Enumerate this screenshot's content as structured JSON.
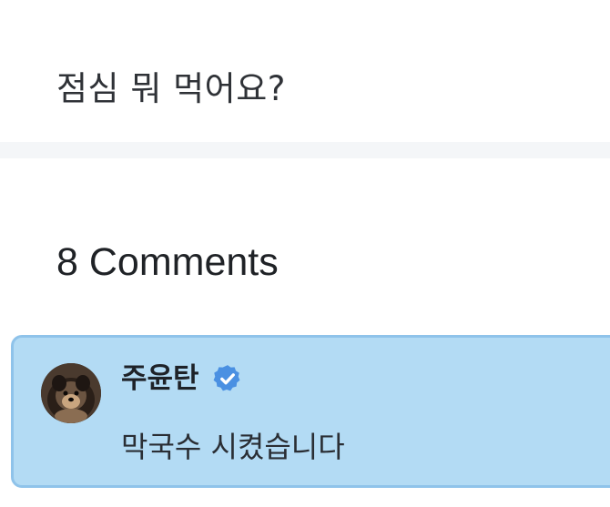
{
  "post": {
    "text": "점심 뭐 먹어요?"
  },
  "comments": {
    "heading": "8 Comments",
    "items": [
      {
        "author": "주윤탄",
        "verified": true,
        "verified_icon": "verified-badge-icon",
        "text": "막국수 시켰습니다",
        "highlight_color": "#b3dbf4",
        "border_color": "#8fc3ea"
      }
    ]
  },
  "colors": {
    "verified_badge": "#4a90e2",
    "divider": "#f4f6f8"
  }
}
